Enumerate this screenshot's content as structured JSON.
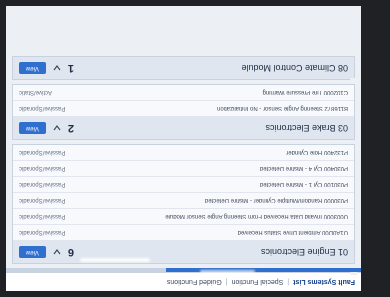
{
  "tabs": {
    "items": [
      "Fault Systems List",
      "Special Function",
      "Guided Functions"
    ],
    "active_index": 0
  },
  "scan_progress": 0.55,
  "modules": [
    {
      "title": "01 Engine Electronics",
      "count": "6",
      "view_label": "View",
      "faults": [
        {
          "desc": "U1A0D00 Ambient Drive Status Received",
          "status": "Passive/Sporadic"
        },
        {
          "desc": "U003000 Invalid Data Received From Steering Angle Sensor Module",
          "status": "Passive/Sporadic"
        },
        {
          "desc": "P030000 Random/Multiple Cylinder - Misfire Detected",
          "status": "Passive/Sporadic"
        },
        {
          "desc": "P030100 Cyl 1 - Misfire Detected",
          "status": "Passive/Sporadic"
        },
        {
          "desc": "P030400 Cyl 4 - Misfire Detected",
          "status": "Passive/Sporadic"
        },
        {
          "desc": "P132400 Hole Cylinder",
          "status": "Passive/Sporadic"
        }
      ]
    },
    {
      "title": "03 Brake Electronics",
      "count": "2",
      "view_label": "View",
      "faults": [
        {
          "desc": "B116872 Steering Angle Sensor - No Initialization",
          "status": "Passive/Sporadic"
        },
        {
          "desc": "C102000 Tire Pressure Warning",
          "status": "Active/Static"
        }
      ]
    },
    {
      "title": "08 Climate Control Module",
      "count": "1",
      "view_label": "View",
      "faults": []
    }
  ],
  "colors": {
    "accent": "#2f6fd0",
    "header_bg": "#dfe6f0",
    "page_bg": "#eceff3"
  }
}
